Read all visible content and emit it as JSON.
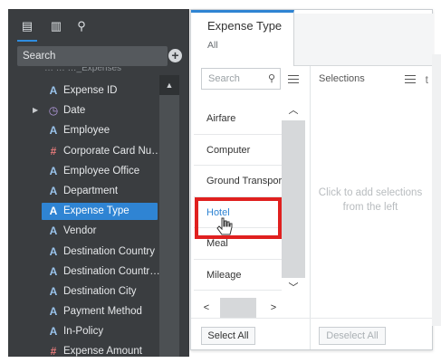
{
  "data_panel": {
    "tabs": [
      {
        "icon": "database-icon",
        "glyph": "▤"
      },
      {
        "icon": "bar-chart-icon",
        "glyph": "▥"
      },
      {
        "icon": "analytics-search-icon",
        "glyph": "⚲"
      }
    ],
    "search_label": "Search",
    "add_glyph": "+",
    "truncated_header": "… … …_Expenses",
    "fields": [
      {
        "icon": "text-field-icon",
        "glyph": "A",
        "label": "Expense ID",
        "type": "a"
      },
      {
        "icon": "clock-icon",
        "glyph": "◷",
        "label": "Date",
        "type": "c",
        "expandable": true
      },
      {
        "icon": "text-field-icon",
        "glyph": "A",
        "label": "Employee",
        "type": "a"
      },
      {
        "icon": "hash-icon",
        "glyph": "#",
        "label": "Corporate Card Nu…",
        "type": "h"
      },
      {
        "icon": "text-field-icon",
        "glyph": "A",
        "label": "Employee Office",
        "type": "a"
      },
      {
        "icon": "text-field-icon",
        "glyph": "A",
        "label": "Department",
        "type": "a"
      },
      {
        "icon": "text-field-icon",
        "glyph": "A",
        "label": "Expense Type",
        "type": "a",
        "selected": true
      },
      {
        "icon": "text-field-icon",
        "glyph": "A",
        "label": "Vendor",
        "type": "a"
      },
      {
        "icon": "text-field-icon",
        "glyph": "A",
        "label": "Destination Country",
        "type": "a"
      },
      {
        "icon": "text-field-icon",
        "glyph": "A",
        "label": "Destination Countr…",
        "type": "a"
      },
      {
        "icon": "text-field-icon",
        "glyph": "A",
        "label": "Destination City",
        "type": "a"
      },
      {
        "icon": "text-field-icon",
        "glyph": "A",
        "label": "Payment Method",
        "type": "a"
      },
      {
        "icon": "text-field-icon",
        "glyph": "A",
        "label": "In-Policy",
        "type": "a"
      },
      {
        "icon": "hash-icon",
        "glyph": "#",
        "label": "Expense Amount",
        "type": "h"
      }
    ]
  },
  "filter_panel": {
    "tab_title": "Expense Type",
    "tab_subtitle": "All",
    "right_partial": "t",
    "search_placeholder": "Search",
    "values": [
      "Airfare",
      "Computer",
      "Ground Transpor",
      "Hotel",
      "Meal",
      "Mileage"
    ],
    "highlighted_value": "Hotel",
    "selections_title": "Selections",
    "selections_hint": "Click to add selections from the left",
    "select_all_label": "Select All",
    "deselect_all_label": "Deselect All",
    "colors": {
      "accent": "#2f84d3",
      "highlight_box": "#e0201f"
    }
  }
}
